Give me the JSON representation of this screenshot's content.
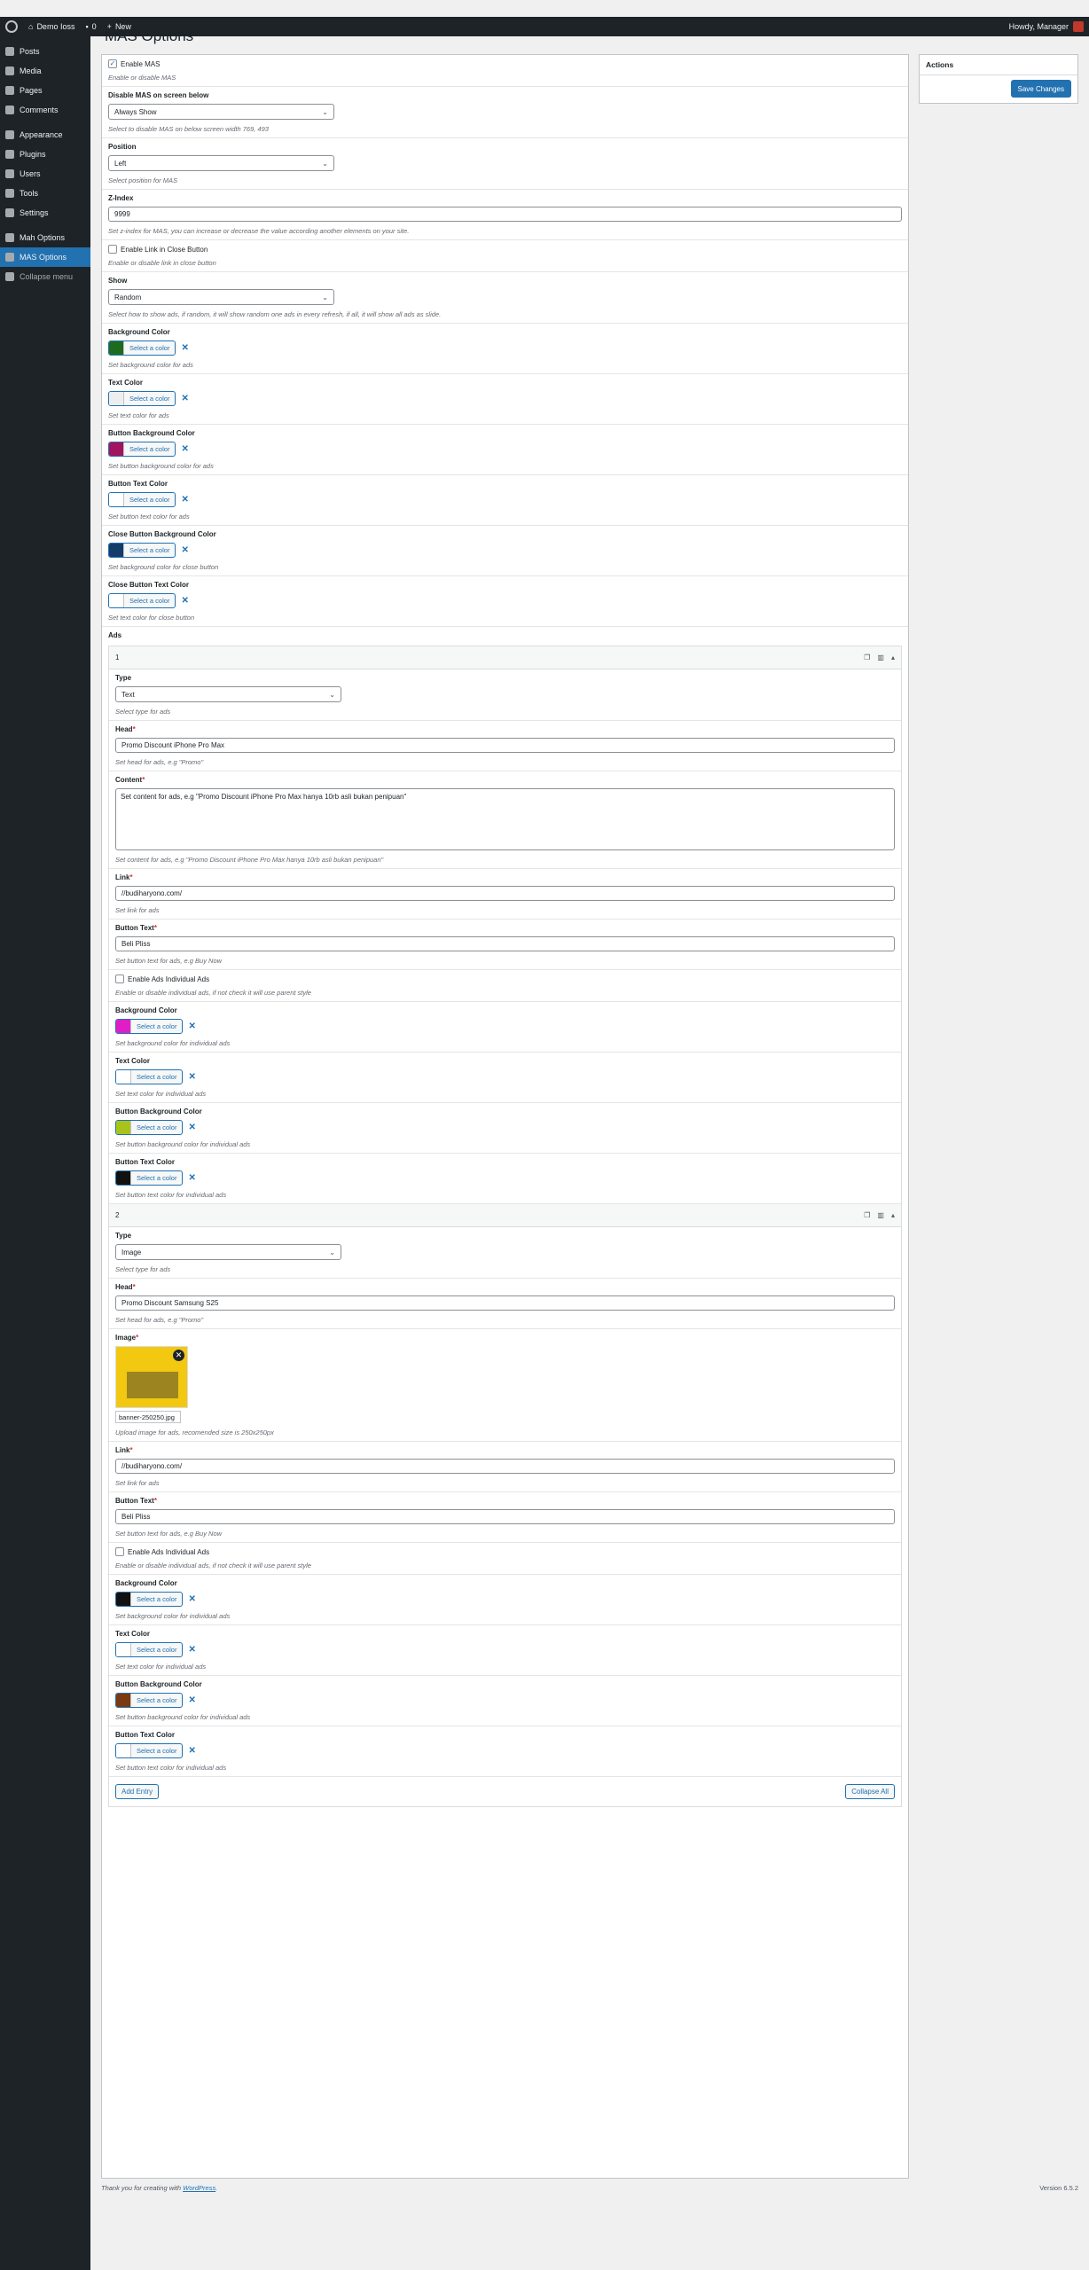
{
  "adminbar": {
    "site_name": "Demo Ioss",
    "comments_count": "0",
    "new_label": "New",
    "howdy": "Howdy, Manager"
  },
  "sidebar": {
    "items": [
      {
        "label": "Posts",
        "icon": "pin-icon"
      },
      {
        "label": "Media",
        "icon": "media-icon"
      },
      {
        "label": "Pages",
        "icon": "page-icon"
      },
      {
        "label": "Comments",
        "icon": "comment-icon"
      },
      {
        "label": "Appearance",
        "icon": "brush-icon"
      },
      {
        "label": "Plugins",
        "icon": "plugin-icon"
      },
      {
        "label": "Users",
        "icon": "user-icon"
      },
      {
        "label": "Tools",
        "icon": "wrench-icon"
      },
      {
        "label": "Settings",
        "icon": "settings-icon"
      },
      {
        "label": "Mah Options",
        "icon": "gear-icon"
      },
      {
        "label": "MAS Options",
        "icon": "gear-icon"
      },
      {
        "label": "Collapse menu",
        "icon": "collapse-icon"
      }
    ]
  },
  "page": {
    "title": "MAS Options"
  },
  "settings": {
    "enable_mas": {
      "label": "Enable MAS",
      "desc": "Enable or disable MAS",
      "checked": true
    },
    "disable_below": {
      "label": "Disable MAS on screen below",
      "value": "Always Show",
      "desc": "Select to disable MAS on below screen width 769, 493"
    },
    "position": {
      "label": "Position",
      "value": "Left",
      "desc": "Select position for MAS"
    },
    "zindex": {
      "label": "Z-Index",
      "value": "9999",
      "desc": "Set z-index for MAS, you can increase or decrease the value according another elements on your site."
    },
    "enable_link": {
      "label": "Enable Link in Close Button",
      "desc": "Enable or disable link in close button"
    },
    "show": {
      "label": "Show",
      "value": "Random",
      "desc": "Select how to show ads, if random, it will show random one ads in every refresh, if all, it will show all ads as slide."
    },
    "colors": [
      {
        "label": "Background Color",
        "color": "#1e6b1e",
        "desc": "Set background color for ads"
      },
      {
        "label": "Text Color",
        "color": "#eeeeee",
        "desc": "Set text color for ads"
      },
      {
        "label": "Button Background Color",
        "color": "#a3145f",
        "desc": "Set button background color for ads"
      },
      {
        "label": "Button Text Color",
        "color": "#ffffff",
        "desc": "Set button text color for ads"
      },
      {
        "label": "Close Button Background Color",
        "color": "#133c6b",
        "desc": "Set background color for close button"
      },
      {
        "label": "Close Button Text Color",
        "color": "#ffffff",
        "desc": "Set text color for close button"
      }
    ],
    "select_color_label": "Select a color"
  },
  "ads": {
    "label": "Ads",
    "entry1": {
      "num": "1",
      "type": {
        "label": "Type",
        "value": "Text",
        "desc": "Select type for ads"
      },
      "head": {
        "label": "Head",
        "value": "Promo Discount iPhone Pro Max",
        "desc": "Set head for ads, e.g \"Promo\""
      },
      "content": {
        "label": "Content",
        "value": "Set content for ads, e.g \"Promo Discount iPhone Pro Max hanya 10rb asli bukan penipuan\"",
        "desc": "Set content for ads, e.g \"Promo Discount iPhone Pro Max hanya 10rb asli bukan penipuan\""
      },
      "link": {
        "label": "Link",
        "value": "//budiharyono.com/",
        "desc": "Set link for ads"
      },
      "button_text": {
        "label": "Button Text",
        "value": "Beli Pliss",
        "desc": "Set button text for ads, e.g Buy Now"
      },
      "individual": {
        "label": "Enable Ads Individual Ads",
        "desc": "Enable or disable individual ads, if not check it will use parent style"
      },
      "colors": [
        {
          "label": "Background Color",
          "color": "#e01ec8",
          "desc": "Set background color for individual ads"
        },
        {
          "label": "Text Color",
          "color": "#ffffff",
          "desc": "Set text color for individual ads"
        },
        {
          "label": "Button Background Color",
          "color": "#a8c41a",
          "desc": "Set button background color for individual ads"
        },
        {
          "label": "Button Text Color",
          "color": "#111111",
          "desc": "Set button text color for individual ads"
        }
      ]
    },
    "entry2": {
      "num": "2",
      "type": {
        "label": "Type",
        "value": "Image",
        "desc": "Select type for ads"
      },
      "head": {
        "label": "Head",
        "value": "Promo Discount Samsung S25",
        "desc": "Set head for ads, e.g \"Promo\""
      },
      "image": {
        "label": "Image",
        "filename": "banner-250250.jpg",
        "desc": "Upload image for ads, recomended size is 250x250px"
      },
      "link": {
        "label": "Link",
        "value": "//budiharyono.com/",
        "desc": "Set link for ads"
      },
      "button_text": {
        "label": "Button Text",
        "value": "Beli Pliss",
        "desc": "Set button text for ads, e.g Buy Now"
      },
      "individual": {
        "label": "Enable Ads Individual Ads",
        "desc": "Enable or disable individual ads, if not check it will use parent style"
      },
      "colors": [
        {
          "label": "Background Color",
          "color": "#111111",
          "desc": "Set background color for individual ads"
        },
        {
          "label": "Text Color",
          "color": "#ffffff",
          "desc": "Set text color for individual ads"
        },
        {
          "label": "Button Background Color",
          "color": "#7a3a12",
          "desc": "Set button background color for individual ads"
        },
        {
          "label": "Button Text Color",
          "color": "#ffffff",
          "desc": "Set button text color for individual ads"
        }
      ]
    },
    "add_entry": "Add Entry",
    "collapse_all": "Collapse All"
  },
  "actions": {
    "title": "Actions",
    "save": "Save Changes"
  },
  "footer": {
    "thanks": "Thank you for creating with",
    "wp_link": "WordPress",
    "version": "Version 6.5.2"
  }
}
